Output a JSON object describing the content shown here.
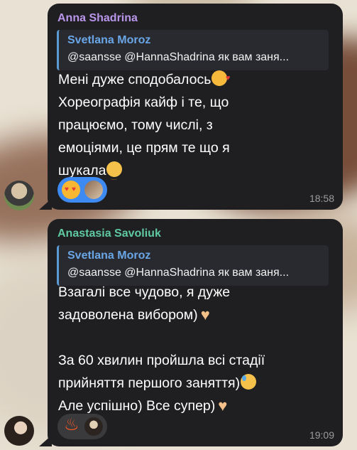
{
  "messages": [
    {
      "sender": "Anna Shadrina",
      "sender_color": "#b996ea",
      "reply": {
        "name": "Svetlana Moroz",
        "text": "@saansse @HannaShadrina як вам заня..."
      },
      "lines": [
        "Мені дуже сподобалось",
        "Хореографія кайф і те, що",
        "працюємо, тому числі, з",
        "емоціями, це прям те що я",
        "шукала"
      ],
      "reactions": {
        "emoji": "heart-eyes-emoji",
        "style": "selected",
        "color": "#3d8bf2"
      },
      "time": "18:58"
    },
    {
      "sender": "Anastasia Savoliuk",
      "sender_color": "#5fc9a2",
      "reply": {
        "name": "Svetlana Moroz",
        "text": "@saansse @HannaShadrina як вам заня..."
      },
      "lines": [
        "Взагалі все чудово, я дуже",
        "задоволена вибором)",
        "",
        "За 60 хвилин пройшла всі стадії",
        "прийняття першого заняття)",
        "Але успішно) Все супер)"
      ],
      "reactions": {
        "emoji": "fire-emoji",
        "style": "default",
        "color": "#3a3a3d"
      },
      "time": "19:09"
    }
  ]
}
